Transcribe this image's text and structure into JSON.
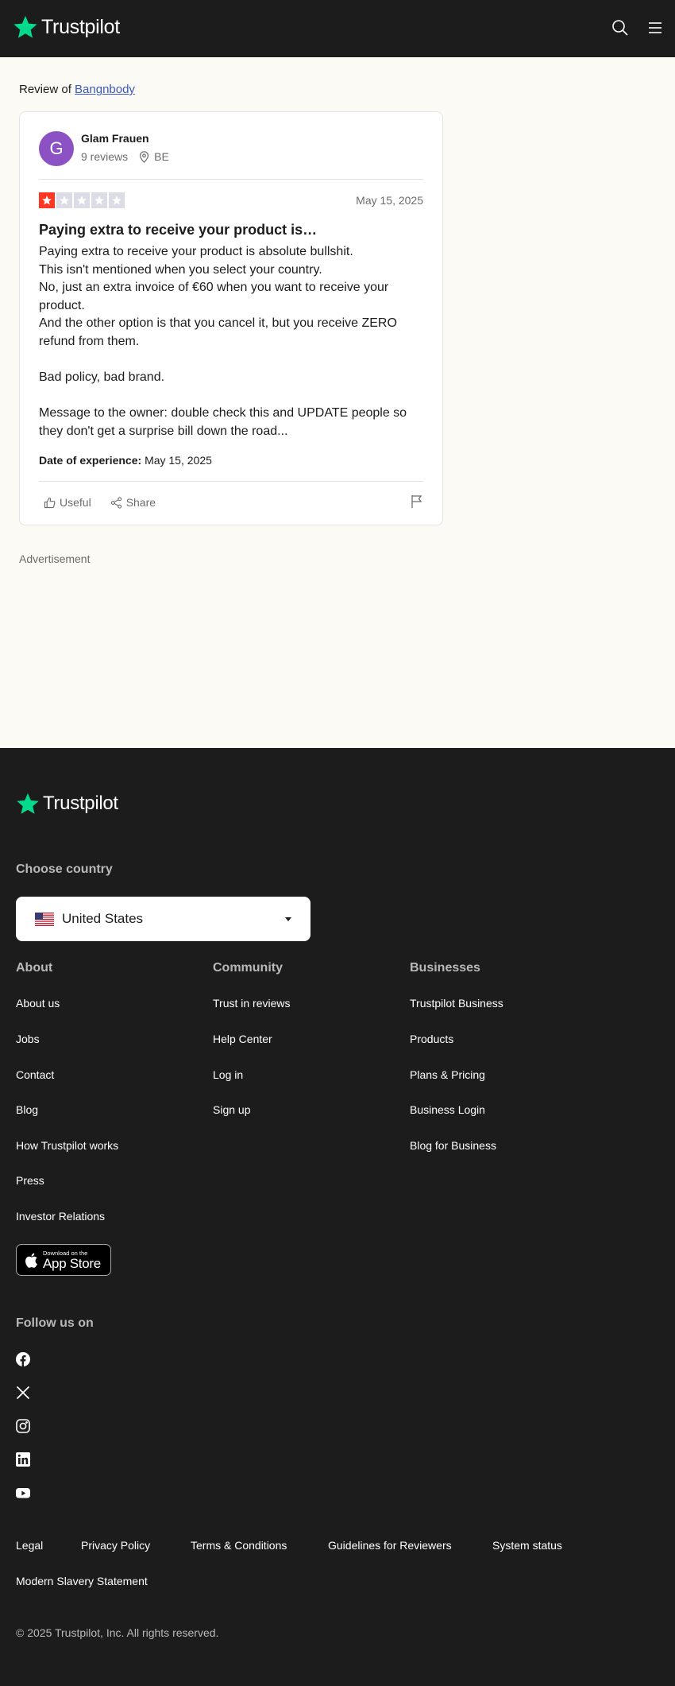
{
  "header": {
    "brand": "Trustpilot"
  },
  "review_context": {
    "prefix": "Review of",
    "business_link": "Bangnbody"
  },
  "review": {
    "avatar_initial": "G",
    "reviewer_name": "Glam Frauen",
    "reviewer_reviews": "9 reviews",
    "reviewer_country": "BE",
    "rating": 1,
    "rating_max": 5,
    "date": "May 15, 2025",
    "title": "Paying extra to receive your product is…",
    "body_lines": [
      "Paying extra to receive your product is absolute bullshit.",
      "This isn't mentioned when you select your country.",
      "No, just an extra invoice of €60 when you want to receive your product.",
      "And the other option is that you cancel it, but you receive ZERO refund from them.",
      "Bad policy, bad brand.",
      "Message to the owner: double check this and UPDATE people so they don't get a surprise bill down the road..."
    ],
    "experience_label": "Date of experience:",
    "experience_date": "May 15, 2025",
    "useful_label": "Useful",
    "share_label": "Share"
  },
  "advertisement_label": "Advertisement",
  "footer": {
    "brand": "Trustpilot",
    "choose_country_label": "Choose country",
    "country_selected": "United States",
    "columns": {
      "about": {
        "title": "About",
        "links": [
          "About us",
          "Jobs",
          "Contact",
          "Blog",
          "How Trustpilot works",
          "Press",
          "Investor Relations"
        ]
      },
      "community": {
        "title": "Community",
        "links": [
          "Trust in reviews",
          "Help Center",
          "Log in",
          "Sign up"
        ]
      },
      "businesses": {
        "title": "Businesses",
        "links": [
          "Trustpilot Business",
          "Products",
          "Plans & Pricing",
          "Business Login",
          "Blog for Business"
        ]
      }
    },
    "app_store": {
      "small": "Download on the",
      "big": "App Store"
    },
    "follow_label": "Follow us on",
    "social_icons": [
      "facebook-icon",
      "x-icon",
      "instagram-icon",
      "linkedin-icon",
      "youtube-icon"
    ],
    "legal_links": [
      "Legal",
      "Privacy Policy",
      "Terms & Conditions",
      "Guidelines for Reviewers",
      "System status",
      "Modern Slavery Statement"
    ],
    "copyright": "© 2025 Trustpilot, Inc. All rights reserved."
  },
  "colors": {
    "brand_green": "#04da8d",
    "star_red": "#ff3722",
    "link_blue": "#3c57bc",
    "footer_bg": "#1c1c1c"
  }
}
